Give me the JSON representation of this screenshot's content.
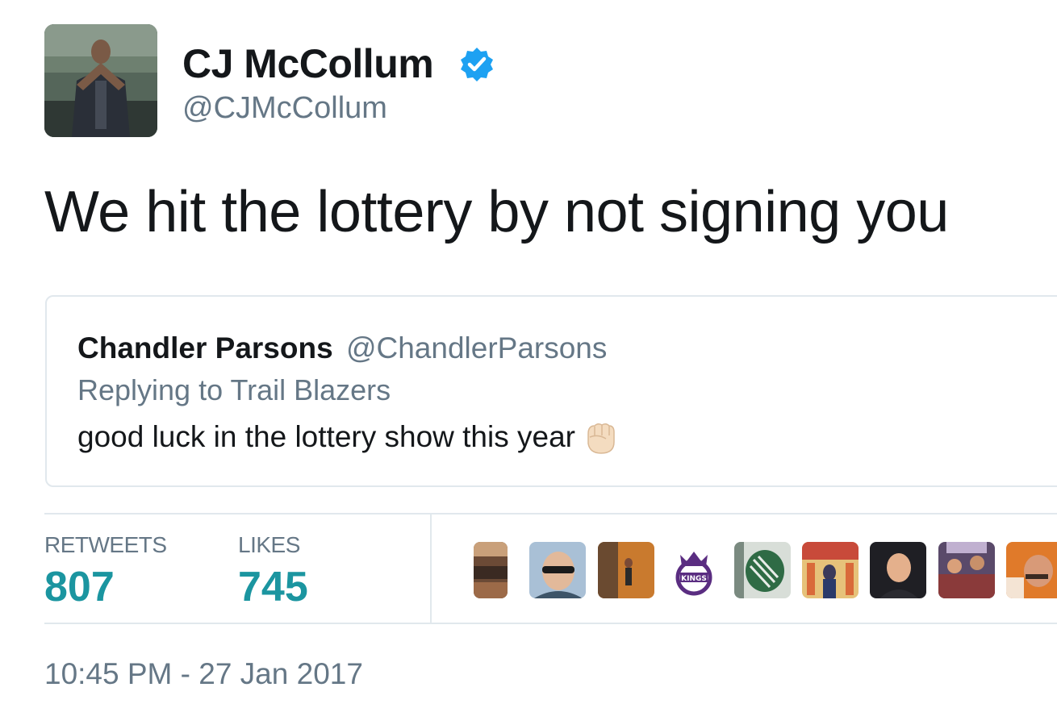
{
  "author": {
    "name": "CJ McCollum",
    "handle": "@CJMcCollum",
    "verified": true,
    "verified_color": "#1da1f2"
  },
  "tweet": {
    "text": "We hit the lottery by not signing you"
  },
  "quoted_tweet": {
    "name": "Chandler Parsons",
    "handle": "@ChandlerParsons",
    "replying_to": "Replying to Trail Blazers",
    "text": "good luck in the lottery show this year",
    "emoji": "raised-fist-icon"
  },
  "stats": {
    "retweets_label": "RETWEETS",
    "retweets_value": "807",
    "likes_label": "LIKES",
    "likes_value": "745",
    "value_color": "#1b95a0"
  },
  "timestamp": "10:45 PM - 27 Jan 2017",
  "likers": [
    {
      "name": "liker-avatar-1"
    },
    {
      "name": "liker-avatar-2"
    },
    {
      "name": "liker-avatar-3"
    },
    {
      "name": "liker-avatar-kings-logo"
    },
    {
      "name": "liker-avatar-5"
    },
    {
      "name": "liker-avatar-6"
    },
    {
      "name": "liker-avatar-7"
    },
    {
      "name": "liker-avatar-8"
    },
    {
      "name": "liker-avatar-9"
    }
  ]
}
